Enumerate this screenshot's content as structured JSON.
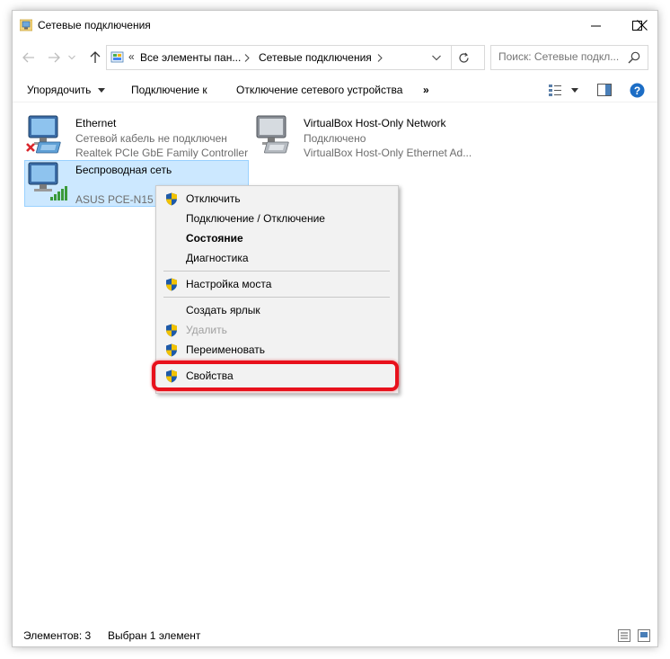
{
  "window": {
    "title": "Сетевые подключения"
  },
  "address": {
    "overflow": "«",
    "crumbs": [
      "Все элементы пан...",
      "Сетевые подключения"
    ],
    "search_placeholder": "Поиск: Сетевые подкл..."
  },
  "toolbar": {
    "organize": "Упорядочить",
    "connect": "Подключение к",
    "disconnect": "Отключение сетевого устройства",
    "more": "»"
  },
  "connections": [
    {
      "name": "Ethernet",
      "status": "Сетевой кабель не подключен",
      "device": "Realtek PCIe GbE Family Controller"
    },
    {
      "name": "VirtualBox Host-Only Network",
      "status": "Подключено",
      "device": "VirtualBox Host-Only Ethernet Ad..."
    },
    {
      "name": "Беспроводная сеть",
      "status": "",
      "device": "ASUS PCE-N15 1"
    }
  ],
  "context_menu": {
    "items": [
      {
        "label": "Отключить",
        "shield": true
      },
      {
        "label": "Подключение / Отключение",
        "shield": false
      },
      {
        "label": "Состояние",
        "shield": false,
        "bold": true
      },
      {
        "label": "Диагностика",
        "shield": false
      },
      {
        "label": "Настройка моста",
        "shield": true
      },
      {
        "label": "Создать ярлык",
        "shield": false
      },
      {
        "label": "Удалить",
        "shield": true,
        "disabled": true
      },
      {
        "label": "Переименовать",
        "shield": true
      },
      {
        "label": "Свойства",
        "shield": true
      }
    ]
  },
  "statusbar": {
    "items_count": "Элементов: 3",
    "selected": "Выбран 1 элемент"
  },
  "colors": {
    "selection": "#cce8ff",
    "highlight": "#e8111c",
    "help": "#1c6dc5"
  }
}
